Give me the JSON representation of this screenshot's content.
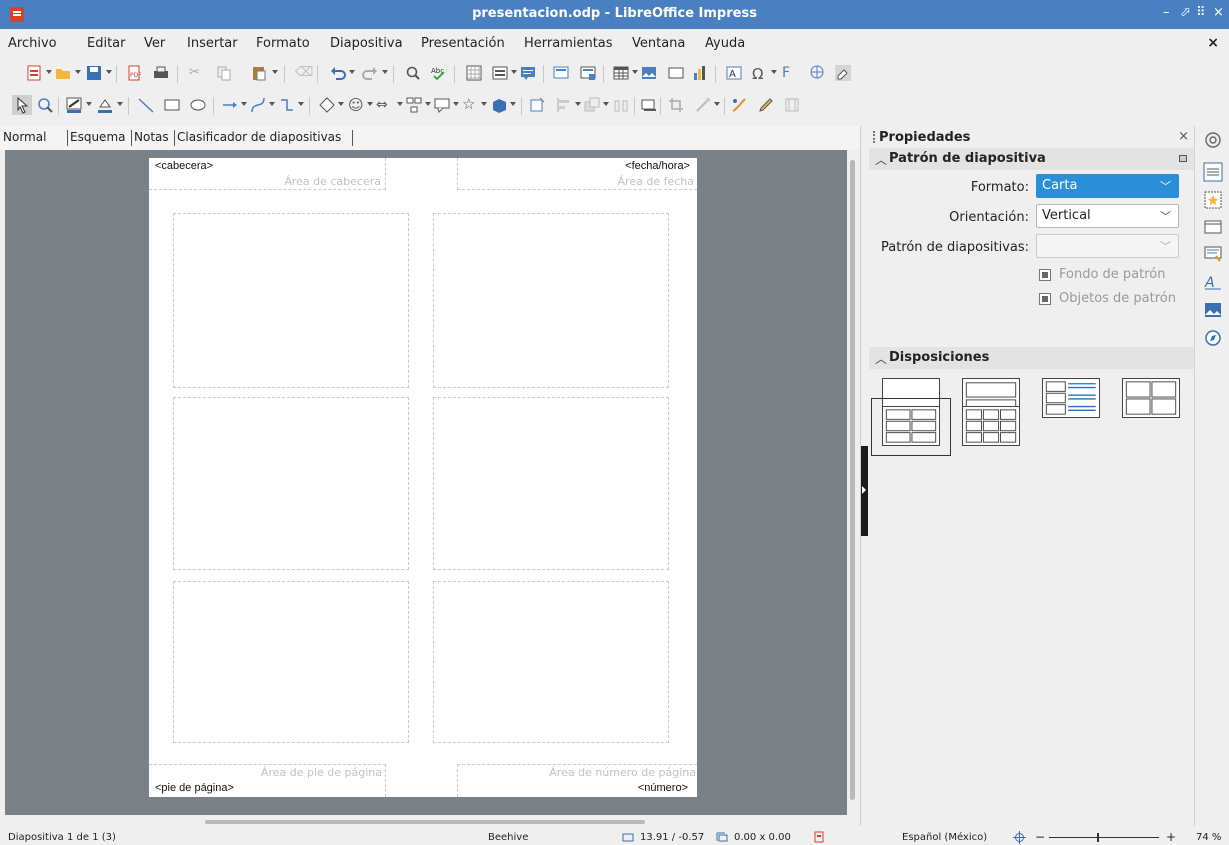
{
  "window": {
    "title": "presentacion.odp - LibreOffice Impress",
    "controls": [
      "–",
      "⬀",
      "⠿",
      "×"
    ]
  },
  "menubar": {
    "items": [
      "Archivo",
      "Editar",
      "Ver",
      "Insertar",
      "Formato",
      "Diapositiva",
      "Presentación",
      "Herramientas",
      "Ventana",
      "Ayuda"
    ],
    "close_label": "×"
  },
  "view_tabs": [
    "Normal",
    "Esquema",
    "Notas",
    "Clasificador de diapositivas"
  ],
  "slide": {
    "header_label": "<cabecera>",
    "header_area": "Área de cabecera",
    "date_label": "<fecha/hora>",
    "date_area": "Área de fecha",
    "footer_label": "<pie de página>",
    "footer_area": "Área de pie de página",
    "number_label": "<número>",
    "number_area": "Área de número de página"
  },
  "sidebar": {
    "title": "Propiedades",
    "close_label": "×",
    "master_section": {
      "title": "Patrón de diapositiva",
      "format_label": "Formato:",
      "format_value": "Carta",
      "orientation_label": "Orientación:",
      "orientation_value": "Vertical",
      "master_label": "Patrón de diapositivas:",
      "master_value": "",
      "background_label": "Fondo de patrón",
      "objects_label": "Objetos de patrón"
    },
    "layouts_section": {
      "title": "Disposiciones"
    }
  },
  "statusbar": {
    "slide_info": "Diapositiva 1 de 1 (3)",
    "master_name": "Beehive",
    "position": "13.91 / -0.57",
    "size": "0.00 x 0.00",
    "language": "Español (México)",
    "zoom_minus": "−",
    "zoom_plus": "+",
    "zoom": "74 %"
  },
  "colors": {
    "titlebar": "#4a7fc1",
    "accent": "#2b8ed8",
    "canvas": "#7b8287"
  }
}
